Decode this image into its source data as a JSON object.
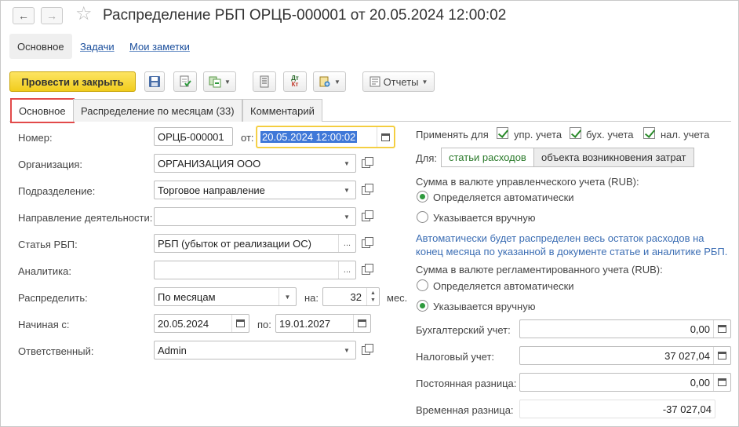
{
  "header": {
    "title": "Распределение РБП ОРЦБ-000001 от 20.05.2024 12:00:02",
    "back_icon": "arrow-left-icon",
    "forward_icon": "arrow-right-icon",
    "favorite_icon": "star-icon"
  },
  "sections": [
    {
      "label": "Основное"
    },
    {
      "label": "Задачи"
    },
    {
      "label": "Мои заметки"
    }
  ],
  "toolbar": {
    "post_close_label": "Провести и закрыть",
    "reports_label": "Отчеты"
  },
  "tabs": [
    {
      "label": "Основное"
    },
    {
      "label": "Распределение по месяцам (33)"
    },
    {
      "label": "Комментарий"
    }
  ],
  "form": {
    "number_label": "Номер:",
    "number_value": "ОРЦБ-000001",
    "from_label": "от:",
    "date_value": "20.05.2024 12:00:02",
    "org_label": "Организация:",
    "org_value": "ОРГАНИЗАЦИЯ ООО",
    "dept_label": "Подразделение:",
    "dept_value": "Торговое направление",
    "direction_label": "Направление деятельности:",
    "direction_value": "",
    "article_label": "Статья РБП:",
    "article_value": "РБП (убыток от реализации ОС)",
    "analytics_label": "Аналитика:",
    "analytics_value": "",
    "distribute_label": "Распределить:",
    "distribute_value": "По месяцам",
    "on_label": "на:",
    "months_value": "32",
    "months_unit": "мес.",
    "start_label": "Начиная с:",
    "start_value": "20.05.2024",
    "to_label": "по:",
    "end_value": "19.01.2027",
    "responsible_label": "Ответственный:",
    "responsible_value": "Admin"
  },
  "right": {
    "apply_label": "Применять для",
    "apply_options": [
      {
        "label": "упр. учета",
        "checked": true
      },
      {
        "label": "бух. учета",
        "checked": true
      },
      {
        "label": "нал. учета",
        "checked": true
      }
    ],
    "for_label": "Для:",
    "for_options": [
      {
        "label": "статьи расходов",
        "selected": true
      },
      {
        "label": "объекта возникновения затрат",
        "selected": false
      }
    ],
    "mgmt_sum_label": "Сумма в валюте управленческого учета (RUB):",
    "mgmt_options": [
      {
        "label": "Определяется автоматически",
        "selected": true
      },
      {
        "label": "Указывается вручную",
        "selected": false
      }
    ],
    "info_line1": "Автоматически будет распределен весь остаток расходов на",
    "info_line2": "конец месяца по указанной в документе статье и аналитике РБП.",
    "reg_sum_label": "Сумма в валюте регламентированного учета (RUB):",
    "reg_options": [
      {
        "label": "Определяется автоматически",
        "selected": false
      },
      {
        "label": "Указывается вручную",
        "selected": true
      }
    ],
    "accounting_label": "Бухгалтерский учет:",
    "accounting_value": "0,00",
    "tax_label": "Налоговый учет:",
    "tax_value": "37 027,04",
    "permanent_label": "Постоянная разница:",
    "permanent_value": "0,00",
    "temporary_label": "Временная разница:",
    "temporary_value": "-37 027,04"
  },
  "colors": {
    "primary_button": "#f5d63a",
    "tab_highlight": "#e24a4a",
    "link": "#1a4e9c",
    "info_text": "#3c6eb4",
    "check_green": "#2f9a3e"
  }
}
